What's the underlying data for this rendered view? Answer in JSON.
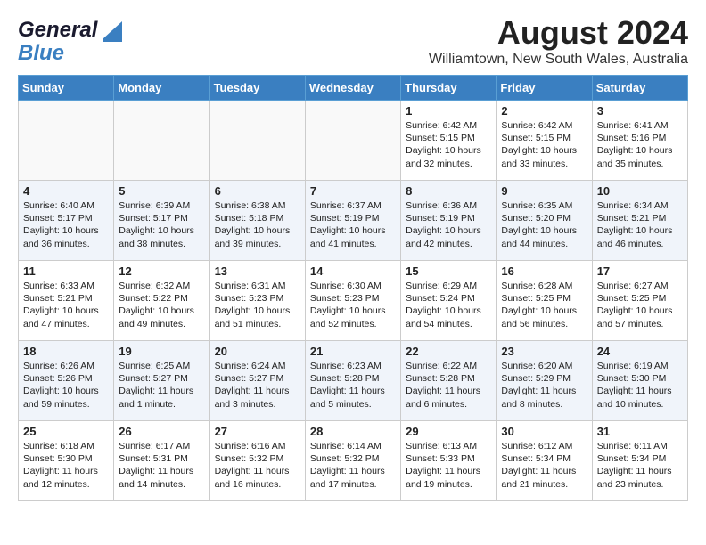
{
  "header": {
    "logo_general": "General",
    "logo_blue": "Blue",
    "title": "August 2024",
    "subtitle": "Williamtown, New South Wales, Australia"
  },
  "days_of_week": [
    "Sunday",
    "Monday",
    "Tuesday",
    "Wednesday",
    "Thursday",
    "Friday",
    "Saturday"
  ],
  "weeks": [
    [
      {
        "day": "",
        "info": ""
      },
      {
        "day": "",
        "info": ""
      },
      {
        "day": "",
        "info": ""
      },
      {
        "day": "",
        "info": ""
      },
      {
        "day": "1",
        "info": "Sunrise: 6:42 AM\nSunset: 5:15 PM\nDaylight: 10 hours\nand 32 minutes."
      },
      {
        "day": "2",
        "info": "Sunrise: 6:42 AM\nSunset: 5:15 PM\nDaylight: 10 hours\nand 33 minutes."
      },
      {
        "day": "3",
        "info": "Sunrise: 6:41 AM\nSunset: 5:16 PM\nDaylight: 10 hours\nand 35 minutes."
      }
    ],
    [
      {
        "day": "4",
        "info": "Sunrise: 6:40 AM\nSunset: 5:17 PM\nDaylight: 10 hours\nand 36 minutes."
      },
      {
        "day": "5",
        "info": "Sunrise: 6:39 AM\nSunset: 5:17 PM\nDaylight: 10 hours\nand 38 minutes."
      },
      {
        "day": "6",
        "info": "Sunrise: 6:38 AM\nSunset: 5:18 PM\nDaylight: 10 hours\nand 39 minutes."
      },
      {
        "day": "7",
        "info": "Sunrise: 6:37 AM\nSunset: 5:19 PM\nDaylight: 10 hours\nand 41 minutes."
      },
      {
        "day": "8",
        "info": "Sunrise: 6:36 AM\nSunset: 5:19 PM\nDaylight: 10 hours\nand 42 minutes."
      },
      {
        "day": "9",
        "info": "Sunrise: 6:35 AM\nSunset: 5:20 PM\nDaylight: 10 hours\nand 44 minutes."
      },
      {
        "day": "10",
        "info": "Sunrise: 6:34 AM\nSunset: 5:21 PM\nDaylight: 10 hours\nand 46 minutes."
      }
    ],
    [
      {
        "day": "11",
        "info": "Sunrise: 6:33 AM\nSunset: 5:21 PM\nDaylight: 10 hours\nand 47 minutes."
      },
      {
        "day": "12",
        "info": "Sunrise: 6:32 AM\nSunset: 5:22 PM\nDaylight: 10 hours\nand 49 minutes."
      },
      {
        "day": "13",
        "info": "Sunrise: 6:31 AM\nSunset: 5:23 PM\nDaylight: 10 hours\nand 51 minutes."
      },
      {
        "day": "14",
        "info": "Sunrise: 6:30 AM\nSunset: 5:23 PM\nDaylight: 10 hours\nand 52 minutes."
      },
      {
        "day": "15",
        "info": "Sunrise: 6:29 AM\nSunset: 5:24 PM\nDaylight: 10 hours\nand 54 minutes."
      },
      {
        "day": "16",
        "info": "Sunrise: 6:28 AM\nSunset: 5:25 PM\nDaylight: 10 hours\nand 56 minutes."
      },
      {
        "day": "17",
        "info": "Sunrise: 6:27 AM\nSunset: 5:25 PM\nDaylight: 10 hours\nand 57 minutes."
      }
    ],
    [
      {
        "day": "18",
        "info": "Sunrise: 6:26 AM\nSunset: 5:26 PM\nDaylight: 10 hours\nand 59 minutes."
      },
      {
        "day": "19",
        "info": "Sunrise: 6:25 AM\nSunset: 5:27 PM\nDaylight: 11 hours\nand 1 minute."
      },
      {
        "day": "20",
        "info": "Sunrise: 6:24 AM\nSunset: 5:27 PM\nDaylight: 11 hours\nand 3 minutes."
      },
      {
        "day": "21",
        "info": "Sunrise: 6:23 AM\nSunset: 5:28 PM\nDaylight: 11 hours\nand 5 minutes."
      },
      {
        "day": "22",
        "info": "Sunrise: 6:22 AM\nSunset: 5:28 PM\nDaylight: 11 hours\nand 6 minutes."
      },
      {
        "day": "23",
        "info": "Sunrise: 6:20 AM\nSunset: 5:29 PM\nDaylight: 11 hours\nand 8 minutes."
      },
      {
        "day": "24",
        "info": "Sunrise: 6:19 AM\nSunset: 5:30 PM\nDaylight: 11 hours\nand 10 minutes."
      }
    ],
    [
      {
        "day": "25",
        "info": "Sunrise: 6:18 AM\nSunset: 5:30 PM\nDaylight: 11 hours\nand 12 minutes."
      },
      {
        "day": "26",
        "info": "Sunrise: 6:17 AM\nSunset: 5:31 PM\nDaylight: 11 hours\nand 14 minutes."
      },
      {
        "day": "27",
        "info": "Sunrise: 6:16 AM\nSunset: 5:32 PM\nDaylight: 11 hours\nand 16 minutes."
      },
      {
        "day": "28",
        "info": "Sunrise: 6:14 AM\nSunset: 5:32 PM\nDaylight: 11 hours\nand 17 minutes."
      },
      {
        "day": "29",
        "info": "Sunrise: 6:13 AM\nSunset: 5:33 PM\nDaylight: 11 hours\nand 19 minutes."
      },
      {
        "day": "30",
        "info": "Sunrise: 6:12 AM\nSunset: 5:34 PM\nDaylight: 11 hours\nand 21 minutes."
      },
      {
        "day": "31",
        "info": "Sunrise: 6:11 AM\nSunset: 5:34 PM\nDaylight: 11 hours\nand 23 minutes."
      }
    ]
  ]
}
